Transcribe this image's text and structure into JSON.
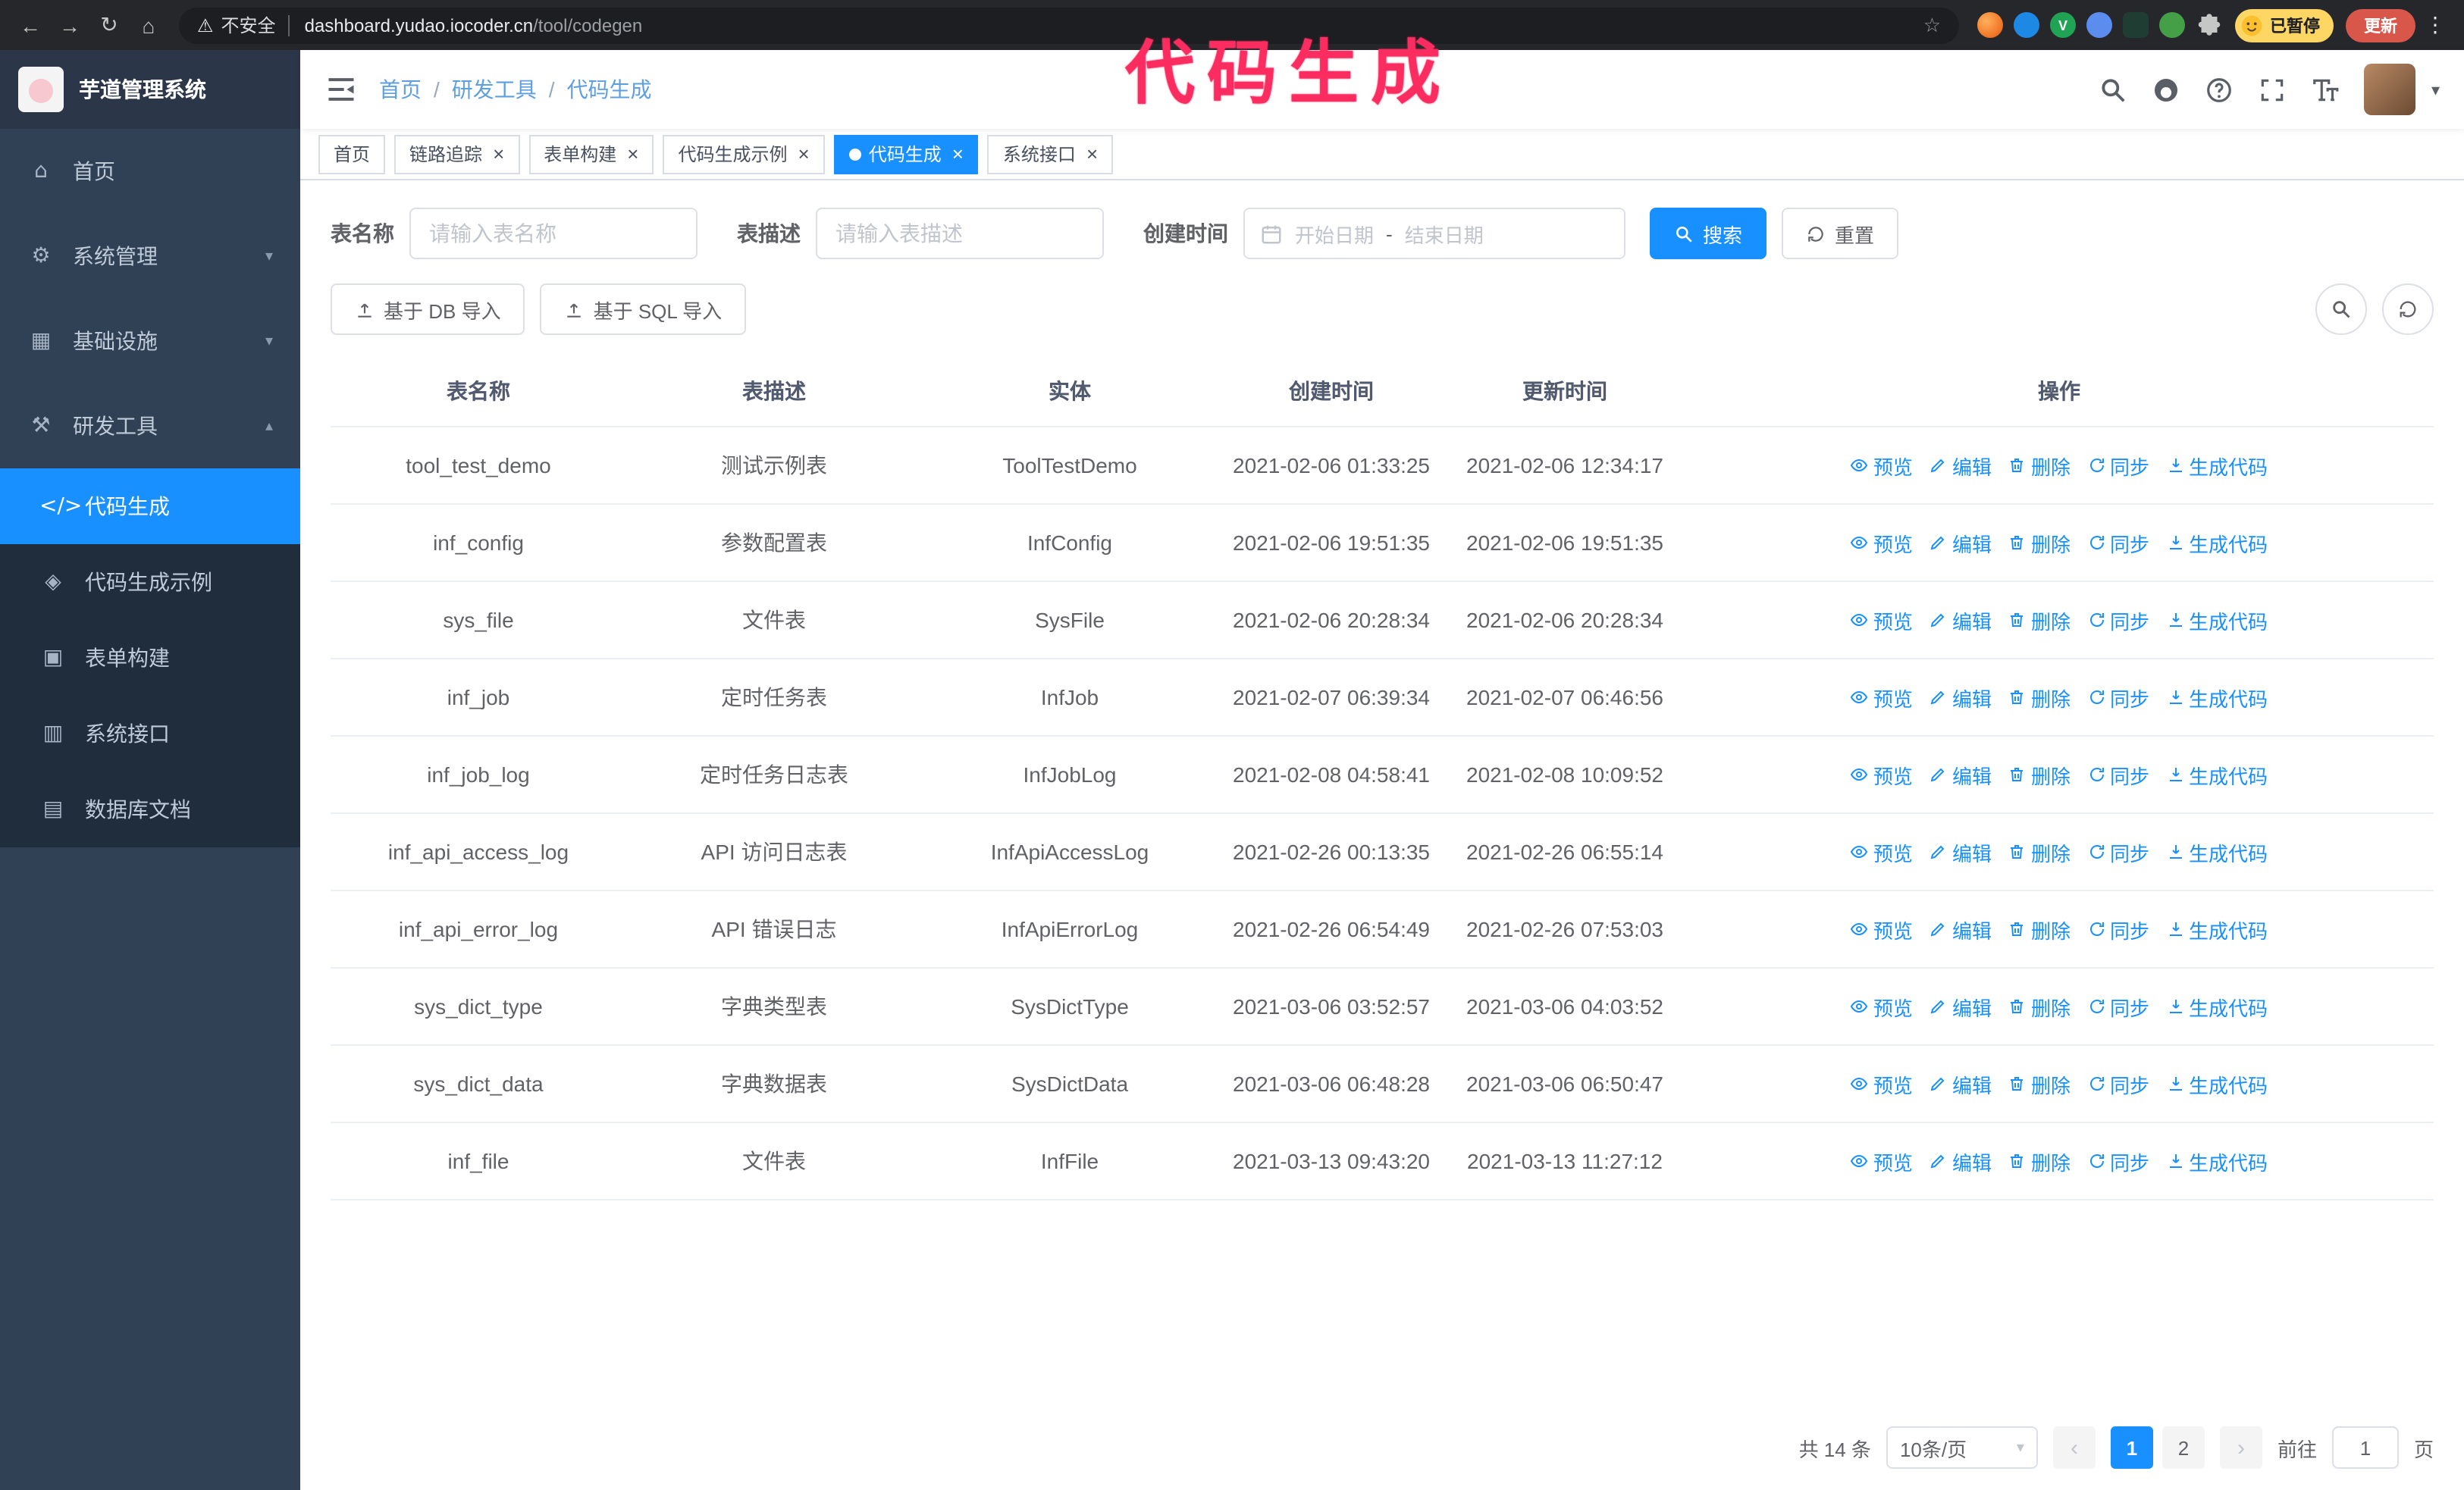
{
  "browser": {
    "security_text": "不安全",
    "url_host": "dashboard.yudao.iocoder.cn",
    "url_path": "/tool/codegen",
    "profile_badge": "已暂停",
    "update_button": "更新"
  },
  "annotation": {
    "text": "代码生成"
  },
  "sidebar": {
    "logo_title": "芋道管理系统",
    "menu": [
      {
        "label": "首页",
        "icon": "home-icon"
      },
      {
        "label": "系统管理",
        "icon": "gear-icon",
        "expandable": true,
        "expanded": false
      },
      {
        "label": "基础设施",
        "icon": "infra-icon",
        "expandable": true,
        "expanded": false
      },
      {
        "label": "研发工具",
        "icon": "tools-icon",
        "expandable": true,
        "expanded": true,
        "children": [
          {
            "label": "代码生成",
            "icon": "code-icon",
            "active": true
          },
          {
            "label": "代码生成示例",
            "icon": "example-icon"
          },
          {
            "label": "表单构建",
            "icon": "form-icon"
          },
          {
            "label": "系统接口",
            "icon": "api-icon"
          },
          {
            "label": "数据库文档",
            "icon": "db-icon"
          }
        ]
      }
    ]
  },
  "navbar": {
    "breadcrumb": [
      "首页",
      "研发工具",
      "代码生成"
    ]
  },
  "tags": [
    {
      "label": "首页",
      "closable": false,
      "active": false
    },
    {
      "label": "链路追踪",
      "closable": true,
      "active": false
    },
    {
      "label": "表单构建",
      "closable": true,
      "active": false
    },
    {
      "label": "代码生成示例",
      "closable": true,
      "active": false
    },
    {
      "label": "代码生成",
      "closable": true,
      "active": true
    },
    {
      "label": "系统接口",
      "closable": true,
      "active": false
    }
  ],
  "filters": {
    "table_name_label": "表名称",
    "table_name_placeholder": "请输入表名称",
    "table_desc_label": "表描述",
    "table_desc_placeholder": "请输入表描述",
    "create_time_label": "创建时间",
    "date_start_placeholder": "开始日期",
    "date_separator": "-",
    "date_end_placeholder": "结束日期",
    "search_button": "搜索",
    "reset_button": "重置"
  },
  "toolbar": {
    "import_db_label": "基于 DB 导入",
    "import_sql_label": "基于 SQL 导入"
  },
  "table": {
    "columns": [
      {
        "key": "name",
        "label": "表名称"
      },
      {
        "key": "desc",
        "label": "表描述"
      },
      {
        "key": "entity",
        "label": "实体"
      },
      {
        "key": "created",
        "label": "创建时间"
      },
      {
        "key": "updated",
        "label": "更新时间"
      },
      {
        "key": "actions",
        "label": "操作"
      }
    ],
    "row_actions": [
      {
        "key": "preview",
        "label": "预览",
        "icon": "eye-icon"
      },
      {
        "key": "edit",
        "label": "编辑",
        "icon": "edit-icon"
      },
      {
        "key": "delete",
        "label": "删除",
        "icon": "delete-icon"
      },
      {
        "key": "sync",
        "label": "同步",
        "icon": "sync-icon"
      },
      {
        "key": "generate",
        "label": "生成代码",
        "icon": "download-icon"
      }
    ],
    "rows": [
      {
        "name": "tool_test_demo",
        "desc": "测试示例表",
        "entity": "ToolTestDemo",
        "created": "2021-02-06 01:33:25",
        "updated": "2021-02-06 12:34:17"
      },
      {
        "name": "inf_config",
        "desc": "参数配置表",
        "entity": "InfConfig",
        "created": "2021-02-06 19:51:35",
        "updated": "2021-02-06 19:51:35"
      },
      {
        "name": "sys_file",
        "desc": "文件表",
        "entity": "SysFile",
        "created": "2021-02-06 20:28:34",
        "updated": "2021-02-06 20:28:34"
      },
      {
        "name": "inf_job",
        "desc": "定时任务表",
        "entity": "InfJob",
        "created": "2021-02-07 06:39:34",
        "updated": "2021-02-07 06:46:56"
      },
      {
        "name": "inf_job_log",
        "desc": "定时任务日志表",
        "entity": "InfJobLog",
        "created": "2021-02-08 04:58:41",
        "updated": "2021-02-08 10:09:52"
      },
      {
        "name": "inf_api_access_log",
        "desc": "API 访问日志表",
        "entity": "InfApiAccessLog",
        "created": "2021-02-26 00:13:35",
        "updated": "2021-02-26 06:55:14"
      },
      {
        "name": "inf_api_error_log",
        "desc": "API 错误日志",
        "entity": "InfApiErrorLog",
        "created": "2021-02-26 06:54:49",
        "updated": "2021-02-26 07:53:03"
      },
      {
        "name": "sys_dict_type",
        "desc": "字典类型表",
        "entity": "SysDictType",
        "created": "2021-03-06 03:52:57",
        "updated": "2021-03-06 04:03:52"
      },
      {
        "name": "sys_dict_data",
        "desc": "字典数据表",
        "entity": "SysDictData",
        "created": "2021-03-06 06:48:28",
        "updated": "2021-03-06 06:50:47"
      },
      {
        "name": "inf_file",
        "desc": "文件表",
        "entity": "InfFile",
        "created": "2021-03-13 09:43:20",
        "updated": "2021-03-13 11:27:12"
      }
    ]
  },
  "pagination": {
    "total_text": "共 14 条",
    "page_size": "10条/页",
    "prev": "‹",
    "next": "›",
    "pages": [
      "1",
      "2"
    ],
    "active_page": "1",
    "goto_label": "前往",
    "goto_value": "1",
    "goto_unit": "页"
  },
  "colors": {
    "accent": "#1890ff",
    "sidebar_bg": "#304156",
    "submenu_bg": "#1f2d3d",
    "annotation": "#fb2c5f",
    "update_button_bg": "#d9574a",
    "profile_badge_bg": "#fdd663"
  }
}
